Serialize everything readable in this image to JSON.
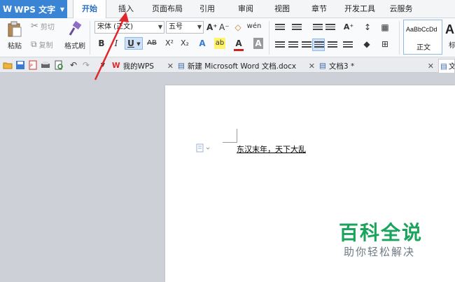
{
  "app": {
    "name": "WPS 文字",
    "logo": "W"
  },
  "menu_tabs": [
    "开始",
    "插入",
    "页面布局",
    "引用",
    "审阅",
    "视图",
    "章节",
    "开发工具",
    "云服务"
  ],
  "active_tab": "开始",
  "ribbon": {
    "paste": "粘贴",
    "cut": "剪切",
    "copy": "复制",
    "format_painter": "格式刷",
    "font_name": "宋体 (正文)",
    "font_size": "五号",
    "grow_font": "A⁺",
    "shrink_font": "A⁻",
    "bold": "B",
    "italic": "I",
    "underline": "U",
    "strikethrough": "AB",
    "superscript": "X²",
    "subscript": "X₂",
    "text_effect": "A",
    "highlight": "ab",
    "font_color": "A",
    "char_shading": "A",
    "style_sample": "AaBbCcDd",
    "style_name": "正文",
    "style_next_sample": "A",
    "style_next_name": "标"
  },
  "quick_access_icons": [
    "open-icon",
    "save-icon",
    "export-pdf-icon",
    "print-icon",
    "print-preview-icon",
    "undo-icon",
    "redo-icon"
  ],
  "doc_tabs": [
    {
      "label": "我的WPS",
      "icon": "wps-logo-icon"
    },
    {
      "label": "新建 Microsoft Word 文档.docx",
      "icon": "word-doc-icon"
    },
    {
      "label": "文档3 *",
      "icon": "doc-icon"
    },
    {
      "label": "文",
      "icon": "doc-icon"
    }
  ],
  "document": {
    "text": "东汉末年，天下大乱"
  },
  "watermark": {
    "title": "百科全说",
    "subtitle": "助你轻松解决"
  },
  "colors": {
    "accent": "#3a84d5",
    "watermark_green": "#1aa35a",
    "annotation_red": "#e0262b"
  }
}
